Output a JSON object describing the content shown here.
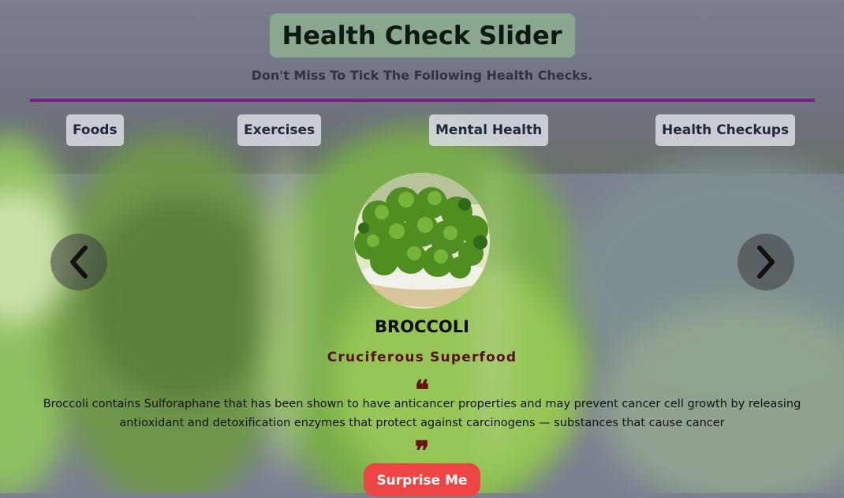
{
  "header": {
    "title": "Health Check Slider",
    "subtitle": "Don't Miss To Tick The Following Health Checks."
  },
  "tabs": [
    {
      "label": "Foods"
    },
    {
      "label": "Exercises"
    },
    {
      "label": "Mental Health"
    },
    {
      "label": "Health Checkups"
    }
  ],
  "slider": {
    "prev_icon": "chevron-left-icon",
    "next_icon": "chevron-right-icon",
    "item": {
      "name": "BROCCOLI",
      "tagline": "Cruciferous Superfood",
      "description": "Broccoli contains Sulforaphane that has been shown to have anticancer properties and may prevent cancer cell growth by releasing antioxidant and detoxification enzymes that protect against carcinogens — substances that cause cancer",
      "quote_open": "❝",
      "quote_close": "❞"
    },
    "cta_label": "Surprise Me"
  },
  "colors": {
    "title_bg": "#8aa88f",
    "divider": "#7a1d86",
    "tagline": "#5a1010",
    "cta": "#ee4444"
  }
}
